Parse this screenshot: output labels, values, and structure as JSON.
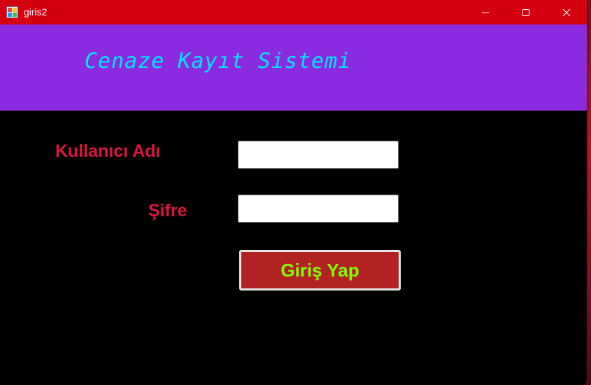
{
  "window": {
    "title": "giris2",
    "controls": {
      "minimize_icon": "minimize-icon",
      "maximize_icon": "maximize-icon",
      "close_icon": "close-icon"
    }
  },
  "header": {
    "title": "Cenaze Kayıt Sistemi"
  },
  "form": {
    "username_label": "Kullanıcı Adı",
    "username_value": "",
    "password_label": "Şifre",
    "password_value": "",
    "submit_label": "Giriş Yap"
  },
  "colors": {
    "titlebar": "#d4000f",
    "header_band": "#8a2be2",
    "header_text": "#00e5ff",
    "background": "#000000",
    "label_text": "#dc143c",
    "button_bg": "#b22222",
    "button_text": "#7fff00"
  }
}
